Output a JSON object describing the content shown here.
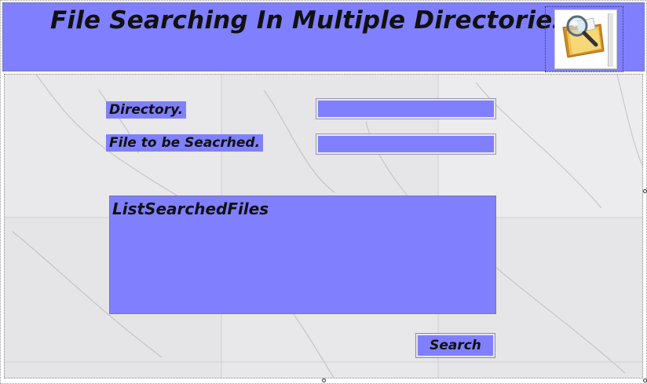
{
  "title": "File Searching In Multiple Directories.",
  "logo": {
    "icon": "folder-search-icon"
  },
  "form": {
    "directory_label": "Directory.",
    "directory_value": "",
    "file_label": "File to be Seacrhed.",
    "file_value": "",
    "list_title": "ListSearchedFiles",
    "search_button": "Search"
  },
  "colors": {
    "accent": "#8080ff",
    "panel": "#e6e6e8"
  }
}
